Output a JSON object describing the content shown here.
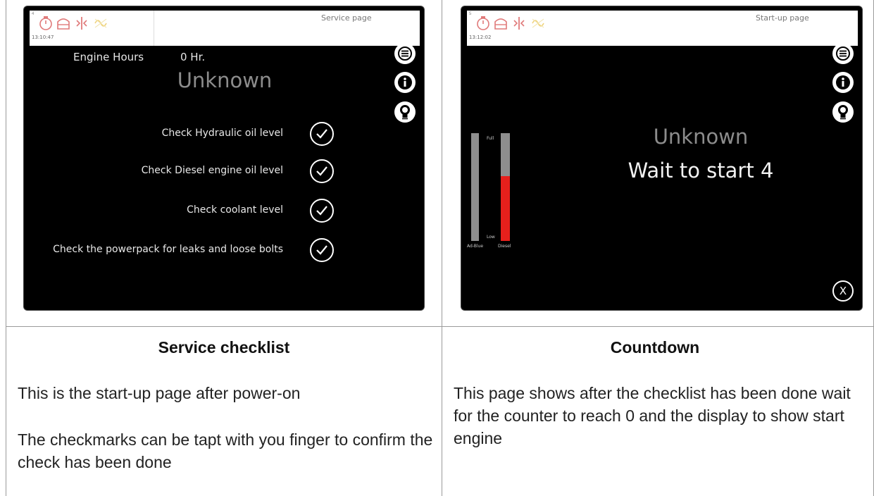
{
  "left_panel": {
    "status": {
      "corner": "4",
      "time": "13:10:47",
      "title": "Service page"
    },
    "engine_hours_label": "Engine Hours",
    "engine_hours_value": "0  Hr.",
    "engine_state": "Unknown",
    "checklist": [
      {
        "label": "Check Hydraulic oil level"
      },
      {
        "label": "Check Diesel engine oil level"
      },
      {
        "label": "Check coolant level"
      },
      {
        "label": "Check the powerpack for leaks and loose bolts"
      }
    ],
    "caption_title": "Service checklist",
    "caption_paragraphs": [
      "This is the start-up page after power-on",
      "The checkmarks can be tapt with you finger to confirm the check has been done"
    ]
  },
  "right_panel": {
    "status": {
      "corner": "5",
      "time": "13:12:02",
      "title": "Start-up page"
    },
    "engine_state": "Unknown",
    "countdown_text": "Wait to start 4",
    "gauges": {
      "full_label": "Full",
      "low_label": "Low",
      "adblue": {
        "label": "Ad-Blue",
        "level": 0
      },
      "diesel": {
        "label": "Diesel",
        "level": 0.6
      }
    },
    "close_label": "X",
    "caption_title": "Countdown",
    "caption_paragraphs": [
      "This page shows after the checklist has been done wait for the counter to reach 0 and the display to show start engine"
    ]
  },
  "colors": {
    "screen_bg": "#000000",
    "gauge_track": "#8e8e8e",
    "gauge_fill": "#e6201c",
    "status_icon": "#e07a7a"
  },
  "icons": [
    "engine-timer-icon",
    "engine-oil-icon",
    "coolant-icon",
    "glow-plug-icon",
    "menu-icon",
    "info-icon",
    "lightbulb-icon",
    "checkmark-icon",
    "close-icon"
  ]
}
